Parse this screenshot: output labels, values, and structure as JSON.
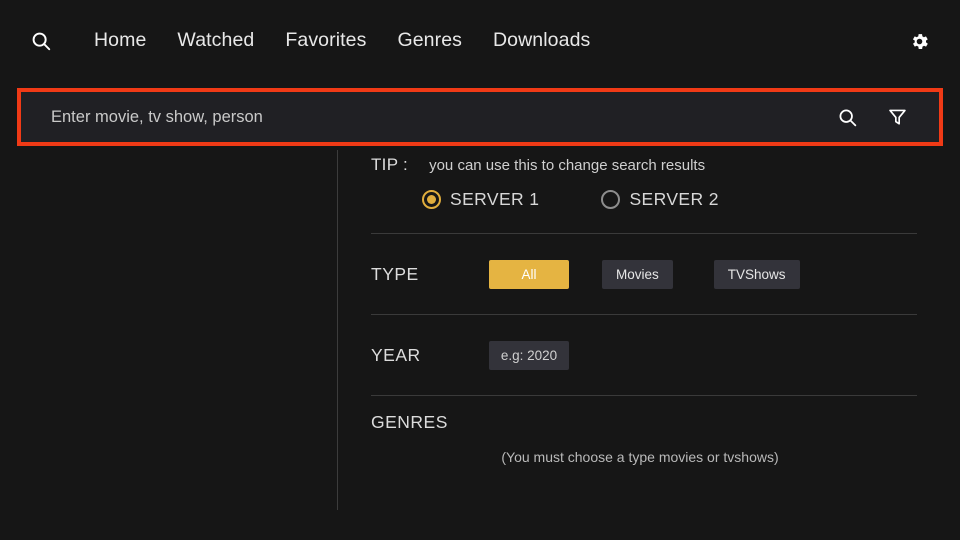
{
  "nav": {
    "search_icon": "search-icon",
    "gear_icon": "gear-icon",
    "links": [
      {
        "label": "Home"
      },
      {
        "label": "Watched"
      },
      {
        "label": "Favorites"
      },
      {
        "label": "Genres"
      },
      {
        "label": "Downloads"
      }
    ]
  },
  "search": {
    "placeholder": "Enter movie, tv show, person",
    "value": "",
    "submit_icon": "search-icon",
    "filter_icon": "filter-funnel-icon",
    "highlight_color": "#f03a16",
    "field_bg": "#202024"
  },
  "filters": {
    "tip": {
      "label": "TIP :",
      "text": "you can use this to change search results"
    },
    "servers": {
      "options": [
        {
          "label": "SERVER 1",
          "selected": true
        },
        {
          "label": "SERVER 2",
          "selected": false
        }
      ],
      "selected_color": "#e0ad3d"
    },
    "type": {
      "label": "TYPE",
      "options": [
        {
          "label": "All",
          "selected": true
        },
        {
          "label": "Movies",
          "selected": false
        },
        {
          "label": "TVShows",
          "selected": false
        }
      ],
      "selected_color": "#e5b442",
      "chip_bg": "#33333a"
    },
    "year": {
      "label": "YEAR",
      "placeholder": "e.g: 2020",
      "value": ""
    },
    "genres": {
      "label": "GENRES",
      "note": "(You must choose a type movies or tvshows)"
    }
  }
}
